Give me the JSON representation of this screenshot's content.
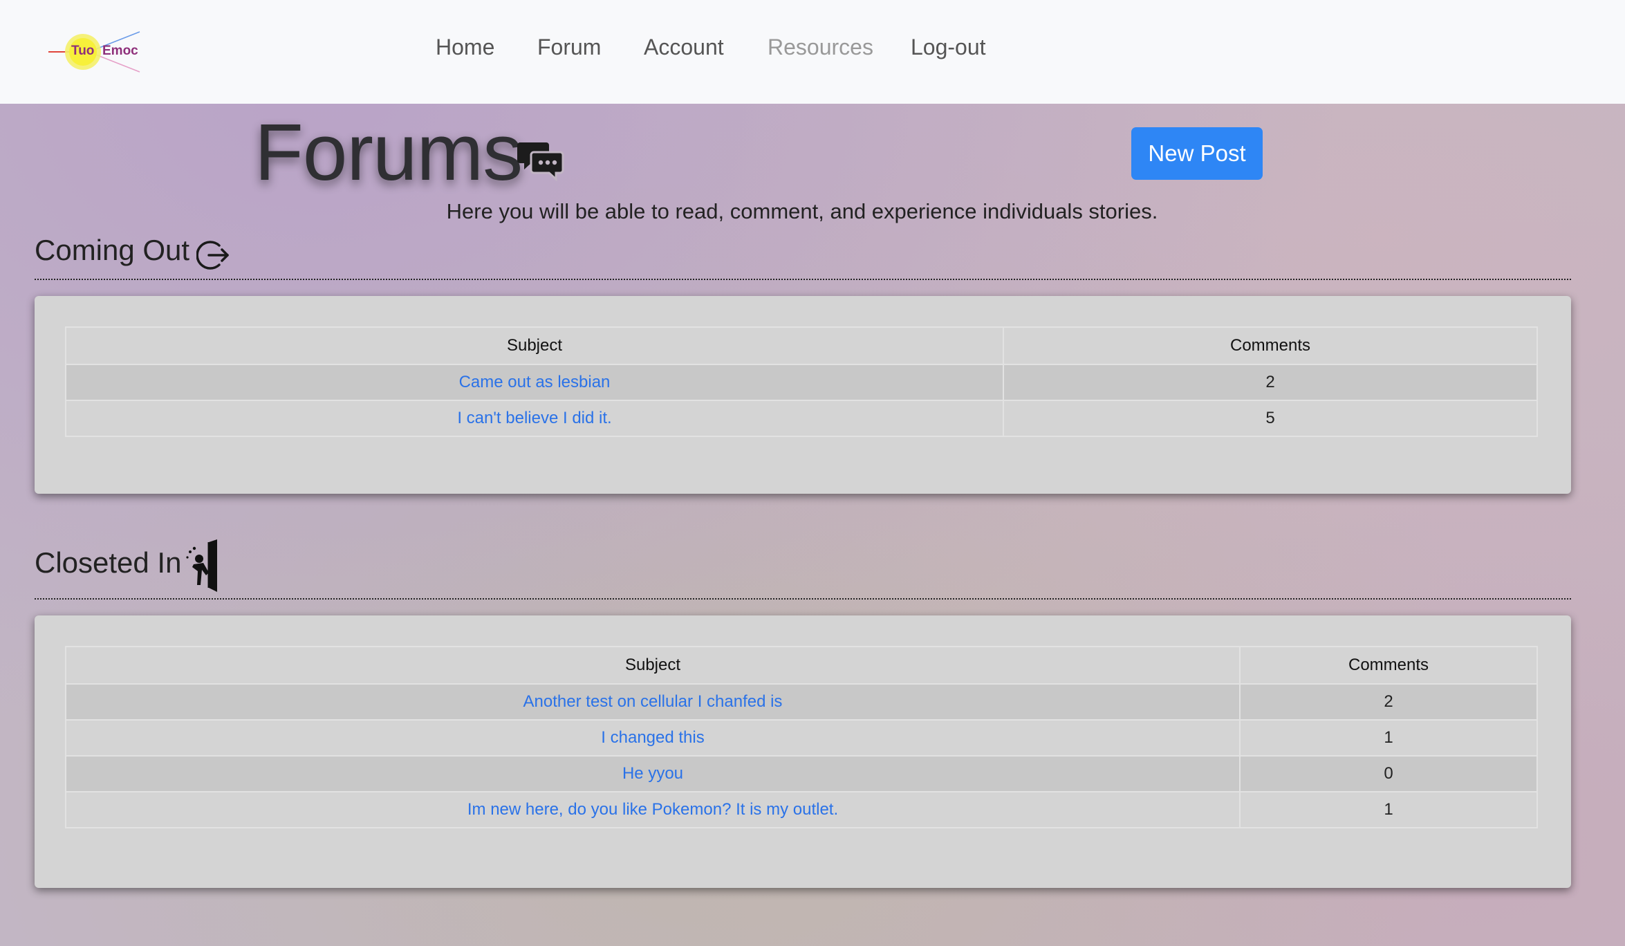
{
  "navbar": {
    "logo": {
      "left": "Tuo",
      "right": "Emoc"
    },
    "links": [
      {
        "label": "Home"
      },
      {
        "label": "Forum"
      },
      {
        "label": "Account"
      },
      {
        "label": "Resources"
      },
      {
        "label": "Log-out"
      }
    ]
  },
  "header": {
    "title": "Forums",
    "new_post_label": "New Post",
    "subtitle": "Here you will be able to read, comment, and experience individuals stories."
  },
  "sections": [
    {
      "title": "Coming Out",
      "icon": "logout-arrow-icon",
      "columns": [
        "Subject",
        "Comments"
      ],
      "rows": [
        {
          "subject": "Came out as lesbian",
          "comments": "2"
        },
        {
          "subject": "I can't believe I did it.",
          "comments": "5"
        }
      ]
    },
    {
      "title": "Closeted In",
      "icon": "closet-door-icon",
      "columns": [
        "Subject",
        "Comments"
      ],
      "rows": [
        {
          "subject": "Another test on cellular I chanfed is",
          "comments": "2"
        },
        {
          "subject": "I changed this",
          "comments": "1"
        },
        {
          "subject": "He yyou",
          "comments": "0"
        },
        {
          "subject": "Im new here, do you like Pokemon? It is my outlet.",
          "comments": "1"
        }
      ]
    }
  ],
  "colors": {
    "accent": "#2e86f5",
    "link": "#2a72e8",
    "card": "#d4d4d4"
  }
}
